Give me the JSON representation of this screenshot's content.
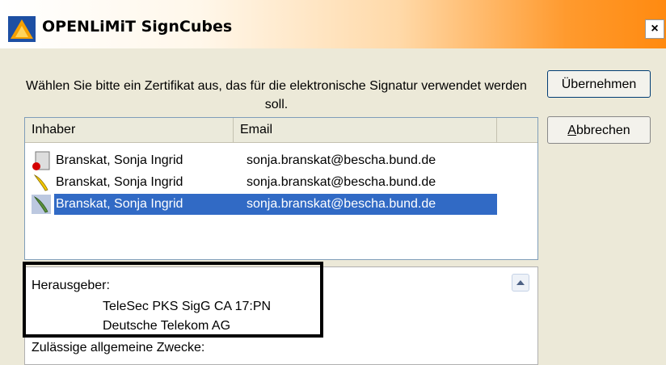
{
  "window": {
    "title": "OPENLiMiT SignCubes",
    "close_label": "×"
  },
  "instruction": "Wählen Sie bitte ein Zertifikat aus, das für die elektronische Signatur verwendet werden soll.",
  "buttons": {
    "ok": "Übernehmen",
    "cancel": "Abbrechen"
  },
  "list": {
    "columns": [
      "Inhaber",
      "Email"
    ],
    "rows": [
      {
        "holder": "Branskat, Sonja Ingrid",
        "email": "sonja.branskat@bescha.bund.de",
        "icon": "certificate-card-icon",
        "selected": false
      },
      {
        "holder": "Branskat, Sonja Ingrid",
        "email": "sonja.branskat@bescha.bund.de",
        "icon": "quill-pen-icon",
        "selected": false
      },
      {
        "holder": "Branskat, Sonja Ingrid",
        "email": "sonja.branskat@bescha.bund.de",
        "icon": "quill-pen-icon",
        "selected": true
      }
    ]
  },
  "details": {
    "issuer_label": "Herausgeber:",
    "issuer_lines": [
      "TeleSec PKS SigG CA 17:PN",
      "Deutsche Telekom AG"
    ],
    "purposes_label": "Zulässige allgemeine Zwecke:"
  },
  "colors": {
    "selection": "#316ac5",
    "title_gradient_end": "#ff8a10"
  }
}
